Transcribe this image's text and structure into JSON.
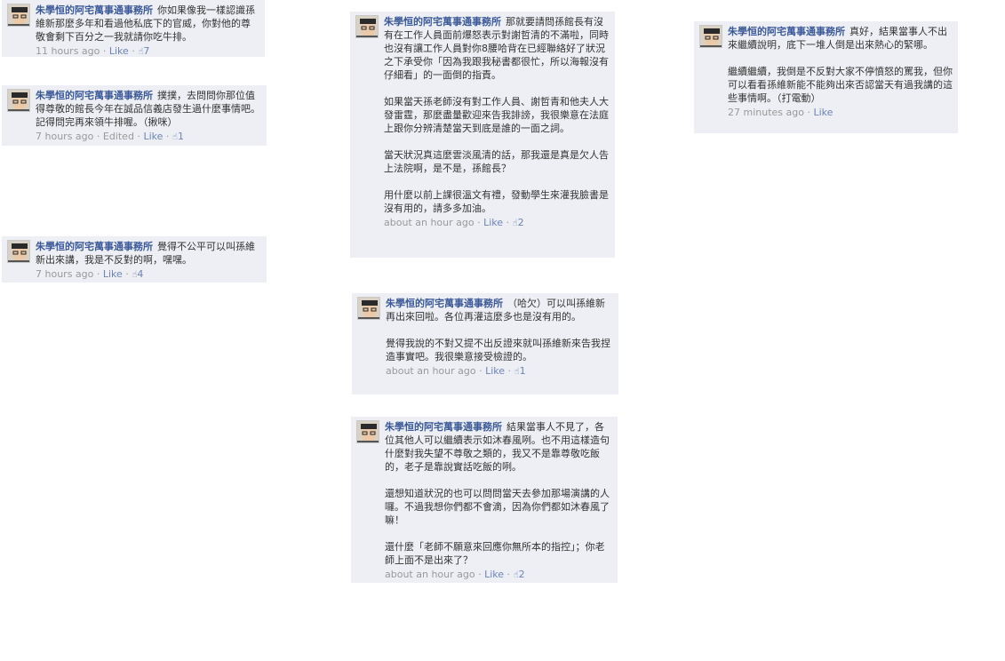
{
  "comments": [
    {
      "author": "朱學恒的阿宅萬事通事務所",
      "text": "你如果像我一樣認識孫維新那麼多年和看過他私底下的官威，你對他的尊敬會剩下百分之一我就請你吃牛排。",
      "time": "11 hours ago",
      "edited": "",
      "like_label": "Like",
      "like_count": "7"
    },
    {
      "author": "朱學恒的阿宅萬事通事務所",
      "text": "撲撲，去問問你那位值得尊敬的館長今年在誠品信義店發生過什麼事情吧。記得問完再來領牛排喔。（揪咪）",
      "time": "7 hours ago",
      "edited": "Edited",
      "like_label": "Like",
      "like_count": "1"
    },
    {
      "author": "朱學恒的阿宅萬事通事務所",
      "text": "覺得不公平可以叫孫維新出來講，我是不反對的啊，嘿嘿。",
      "time": "7 hours ago",
      "edited": "",
      "like_label": "Like",
      "like_count": "4"
    },
    {
      "author": "朱學恒的阿宅萬事通事務所",
      "text": "那就要請問孫館長有沒有在工作人員面前爆怒表示對謝哲清的不滿啦，同時也沒有讓工作人員對你8腰哈背在已經聯絡好了狀況之下承受你「因為我跟我秘書都很忙，所以海報沒有仔細看」的一面倒的指責。\n\n如果當天孫老師沒有對工作人員、謝哲青和他夫人大發雷霆，那麼盡量歡迎來告我誹謗，我很樂意在法庭上跟你分辨清楚當天到底是誰的一面之詞。\n\n當天狀況真這麼雲淡風清的話，那我還是真是欠人告上法院啊，是不是，孫館長？\n\n用什麼以前上課很溫文有禮，發動學生來灌我臉書是沒有用的，請多多加油。",
      "time": "about an hour ago",
      "edited": "",
      "like_label": "Like",
      "like_count": "2"
    },
    {
      "author": "朱學恒的阿宅萬事通事務所",
      "text": "（哈欠）可以叫孫維新再出來回啦。各位再灌這麼多也是沒有用的。\n\n覺得我說的不對又提不出反證來就叫孫維新來告我捏造事實吧。我很樂意接受檢證的。",
      "time": "about an hour ago",
      "edited": "",
      "like_label": "Like",
      "like_count": "1"
    },
    {
      "author": "朱學恒的阿宅萬事通事務所",
      "text": "結果當事人不見了，各位其他人可以繼續表示如沐春風咧。也不用這樣造句什麼對我失望不尊敬之類的，我又不是靠尊敬吃飯的，老子是靠說實話吃飯的咧。\n\n還想知道狀況的也可以問問當天去參加那場演講的人囉。不過我想你們都不會滴，因為你們都如沐春風了嘛！\n\n還什麼「老師不願意來回應你無所本的指控」；你老師上面不是出來了？",
      "time": "about an hour ago",
      "edited": "",
      "like_label": "Like",
      "like_count": "2"
    },
    {
      "author": "朱學恒的阿宅萬事通事務所",
      "text": "真好，結果當事人不出來繼續說明，底下一堆人倒是出來熱心的緊哪。\n\n繼續繼續，我倒是不反對大家不停憤怒的罵我，但你可以看看孫維新能不能夠出來否認當天有過我講的這些事情啊。（打電動）",
      "time": "27 minutes ago",
      "edited": "",
      "like_label": "Like",
      "like_count": ""
    }
  ]
}
